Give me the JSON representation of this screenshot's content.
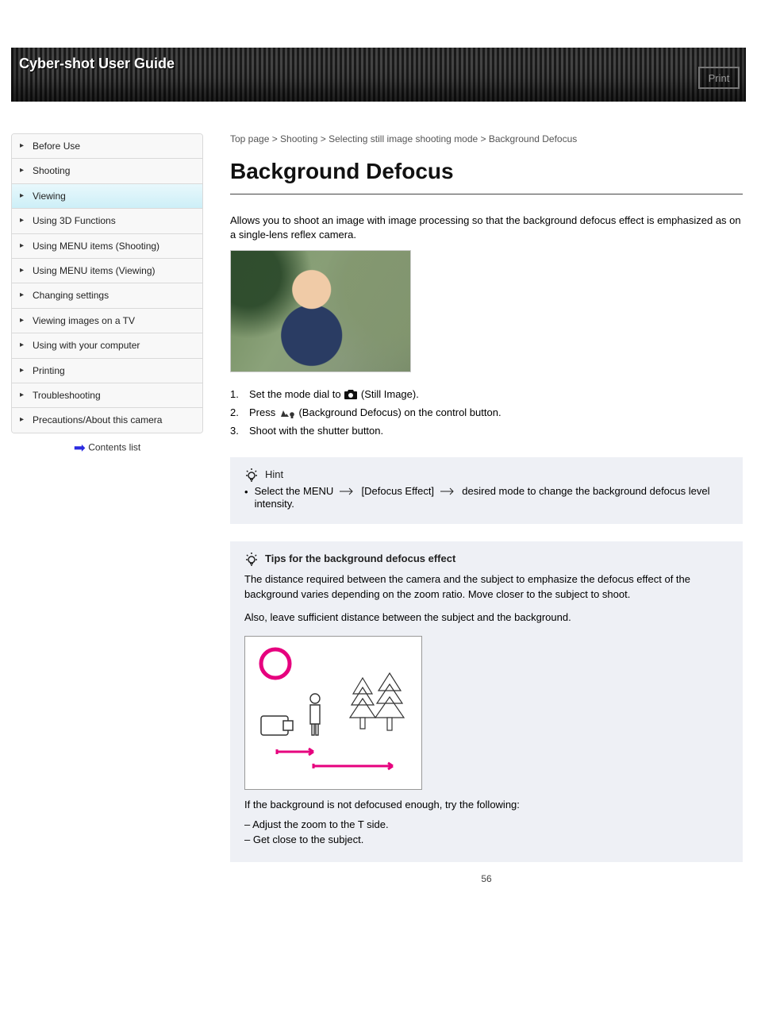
{
  "banner": {
    "title": "Cyber-shot User Guide",
    "print_label": "Print"
  },
  "sidebar": {
    "items": [
      {
        "label": "Before Use"
      },
      {
        "label": "Shooting"
      },
      {
        "label": "Viewing"
      },
      {
        "label": "Using 3D Functions"
      },
      {
        "label": "Using MENU items (Shooting)"
      },
      {
        "label": "Using MENU items (Viewing)"
      },
      {
        "label": "Changing settings"
      },
      {
        "label": "Viewing images on a TV"
      },
      {
        "label": "Using with your computer"
      },
      {
        "label": "Printing"
      },
      {
        "label": "Troubleshooting"
      },
      {
        "label": "Precautions/About this camera"
      }
    ],
    "active_index": 2,
    "footer_label": "Contents list"
  },
  "page": {
    "breadcrumb": "Top page > Shooting > Selecting still image shooting mode > Background Defocus",
    "title": "Background Defocus",
    "intro": "Allows you to shoot an image with image processing so that the background defocus effect is emphasized as on a single-lens reflex camera.",
    "steps": [
      {
        "num": "1.",
        "text_before": "Set the mode dial to ",
        "text_after": " (Still Image)."
      },
      {
        "num": "2.",
        "text_before": "Press ",
        "text_after": " (Background Defocus) on the control button."
      },
      {
        "num": "3.",
        "text_before": "Shoot with the shutter button.",
        "text_after": ""
      }
    ],
    "hint_label": "Hint",
    "hint_bullet_prefix": "Select the MENU ",
    "hint_bullet_mid": " [Defocus Effect] ",
    "hint_bullet_suffix": " desired mode to change the background defocus level intensity.",
    "tip_label": "Tips for the background defocus effect",
    "tip_para1": "The distance required between the camera and the subject to emphasize the defocus effect of the background varies depending on the zoom ratio. Move closer to the subject to shoot.",
    "tip_para2": "Also, leave sufficient distance between the subject and the background.",
    "tip_para3": "If the background is not defocused enough, try the following:",
    "tip_list": [
      "Adjust the zoom to the T side.",
      "Get close to the subject."
    ],
    "page_number": "56"
  }
}
